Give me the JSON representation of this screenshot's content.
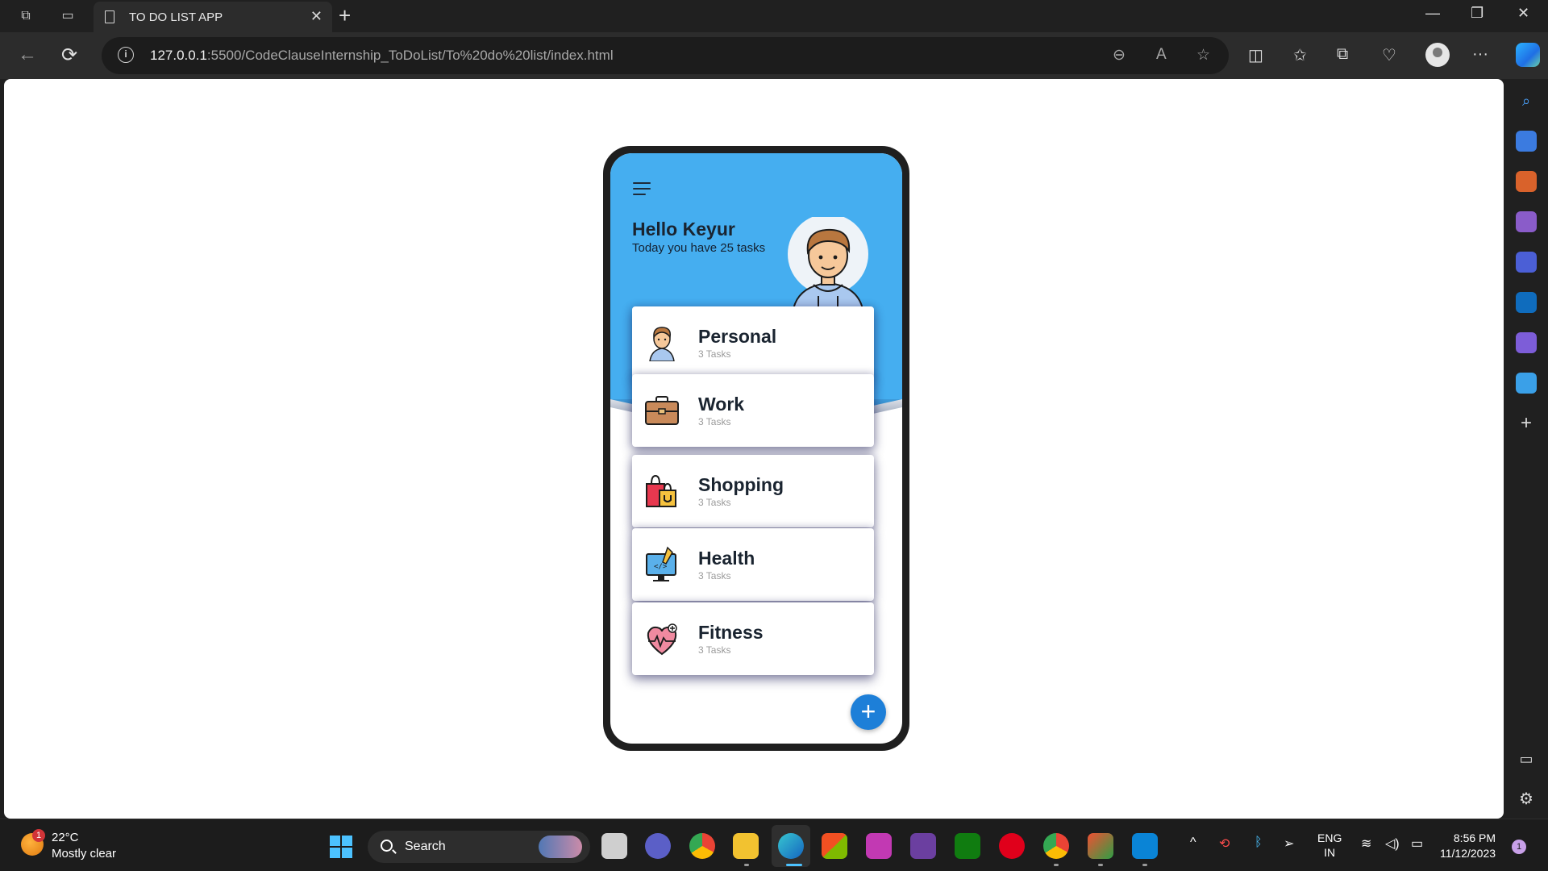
{
  "browser": {
    "tab_title": "TO DO LIST APP",
    "url_host": "127.0.0.1",
    "url_rest": ":5500/CodeClauseInternship_ToDoList/To%20do%20list/index.html",
    "close_glyph": "✕",
    "new_tab_glyph": "+",
    "minimize_glyph": "—",
    "restore_glyph": "❐",
    "window_close_glyph": "✕",
    "back_glyph": "←",
    "refresh_glyph": "⟳",
    "info_glyph": "i",
    "zoom_glyph": "⊖",
    "read_aloud_glyph": "A",
    "favorite_glyph": "☆",
    "split_glyph": "◫",
    "favorites_glyph": "✩",
    "collections_glyph": "⧉",
    "health_glyph": "♡",
    "more_glyph": "···"
  },
  "app": {
    "greeting": "Hello Keyur",
    "subtitle": "Today you have 25 tasks",
    "fab_label": "+",
    "categories": [
      {
        "title": "Personal",
        "count": "3 Tasks",
        "icon": "person-icon"
      },
      {
        "title": "Work",
        "count": "3 Tasks",
        "icon": "briefcase-icon"
      },
      {
        "title": "Shopping",
        "count": "3 Tasks",
        "icon": "shopping-bags-icon"
      },
      {
        "title": "Health",
        "count": "3 Tasks",
        "icon": "monitor-code-icon"
      },
      {
        "title": "Fitness",
        "count": "3 Tasks",
        "icon": "heart-pulse-icon"
      }
    ]
  },
  "sidebar": {
    "icons": [
      "search-icon",
      "tag-icon",
      "toolbox-icon",
      "chess-icon",
      "copilot-app-icon",
      "outlook-icon",
      "editor-icon",
      "send-icon",
      "add-icon",
      "panel-icon",
      "settings-icon"
    ],
    "add_glyph": "+",
    "panel_glyph": "▭",
    "settings_glyph": "⚙"
  },
  "taskbar": {
    "weather_badge": "1",
    "weather_temp": "22°C",
    "weather_desc": "Mostly clear",
    "search_label": "Search",
    "lang_line1": "ENG",
    "lang_line2": "IN",
    "time": "8:56 PM",
    "date": "11/12/2023",
    "notification_count": "1",
    "tray_chevron": "^",
    "tray_wifi": "≋",
    "tray_volume": "◁)",
    "tray_battery": "▭"
  },
  "colors": {
    "hero": "#45aef0",
    "fab": "#1d7fd8",
    "accent": "#4cc2ff"
  }
}
